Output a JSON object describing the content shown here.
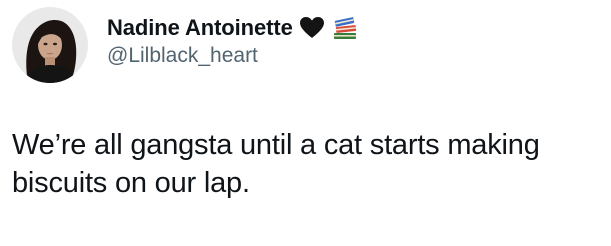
{
  "author": {
    "display_name": "Nadine Antoinette",
    "handle": "@Lilblack_heart",
    "name_emojis": [
      "black-heart-icon",
      "books-icon"
    ],
    "avatar": "profile-photo"
  },
  "tweet": {
    "text": "We’re all gangsta until a cat starts making\nbiscuits on our lap."
  },
  "colors": {
    "text_primary": "#0f1419",
    "text_secondary": "#536471",
    "background": "#ffffff"
  }
}
